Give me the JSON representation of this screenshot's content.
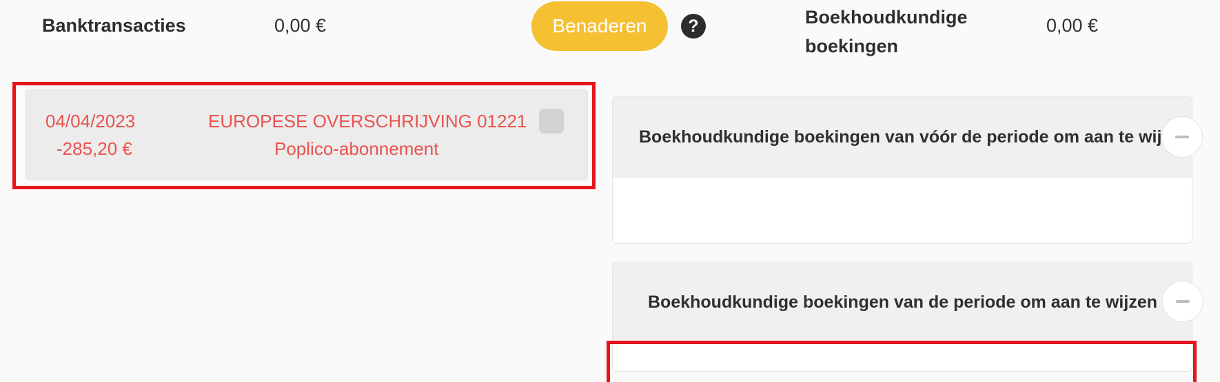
{
  "header": {
    "bank_label": "Banktransacties",
    "bank_amount": "0,00 €",
    "approach_button": "Benaderen",
    "help_glyph": "?",
    "accounting_label": "Boekhoudkundige boekingen",
    "accounting_amount": "0,00 €"
  },
  "transaction": {
    "date": "04/04/2023",
    "amount": "-285,20 €",
    "title": "EUROPESE OVERSCHRIJVING 01221",
    "subtitle": "Poplico-abonnement"
  },
  "panels": [
    {
      "title": "Boekhoudkundige boekingen van vóór de periode om aan te wijzen"
    },
    {
      "title": "Boekhoudkundige boekingen van de periode om aan te wijzen"
    }
  ],
  "icons": {
    "help": "question-circle-icon",
    "collapse": "minus-icon"
  },
  "colors": {
    "accent": "#f5c133",
    "transaction_text": "#e9534f",
    "highlight": "#e3161b"
  }
}
